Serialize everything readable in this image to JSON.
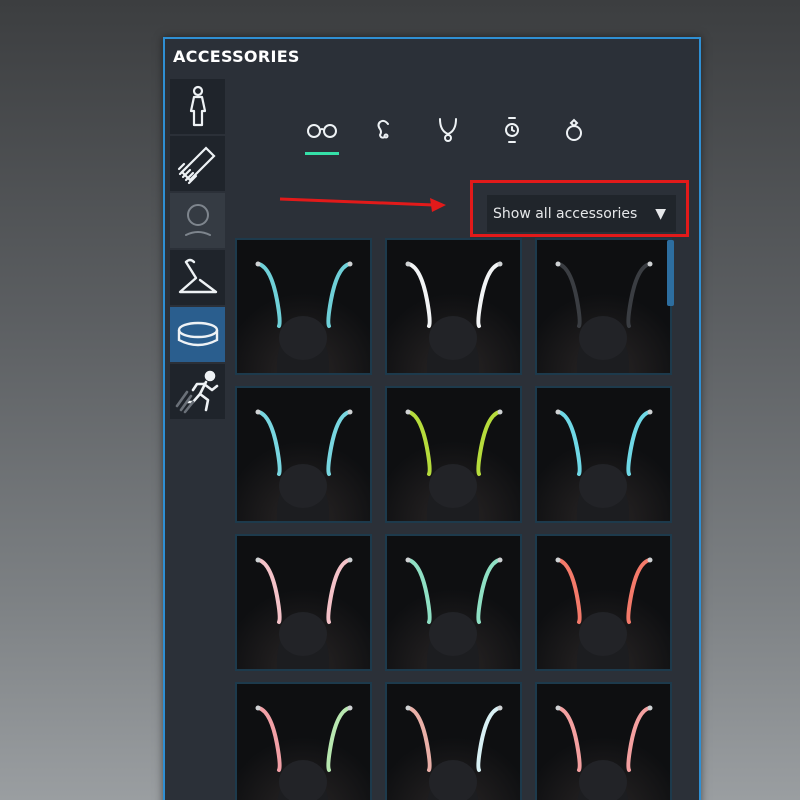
{
  "panel": {
    "title": "ACCESSORIES",
    "border_color": "#2f8fd3"
  },
  "sidebar": {
    "items": [
      {
        "name": "body-icon",
        "state": "normal"
      },
      {
        "name": "comb-icon",
        "state": "normal"
      },
      {
        "name": "head-icon",
        "state": "disabled"
      },
      {
        "name": "hanger-icon",
        "state": "normal"
      },
      {
        "name": "ring-band-icon",
        "state": "active"
      },
      {
        "name": "running-man-icon",
        "state": "normal"
      }
    ]
  },
  "category_tabs": [
    {
      "name": "glasses-icon",
      "selected": true
    },
    {
      "name": "ear-icon",
      "selected": false
    },
    {
      "name": "necklace-icon",
      "selected": false
    },
    {
      "name": "watch-icon",
      "selected": false
    },
    {
      "name": "ring-icon",
      "selected": false
    }
  ],
  "filter": {
    "label": "Show all accessories",
    "arrow": "▼"
  },
  "annotation": {
    "color": "#e21a1a"
  },
  "accessories": [
    {
      "left": "#6fd0d8",
      "right": "#6fd0d8"
    },
    {
      "left": "#f2f4f5",
      "right": "#f2f4f5"
    },
    {
      "left": "#3a3d42",
      "right": "#3a3d42"
    },
    {
      "left": "#78d6e0",
      "right": "#78d6e0"
    },
    {
      "left": "#b6dc3c",
      "right": "#b6dc3c"
    },
    {
      "left": "#6fd8e6",
      "right": "#6fd8e6"
    },
    {
      "left": "#f4c2c8",
      "right": "#f4c2c8"
    },
    {
      "left": "#8fe0c4",
      "right": "#8fe0c4"
    },
    {
      "left": "#f47a6a",
      "right": "#f47a6a"
    },
    {
      "left": "#f2a0a6",
      "right": "#b8e8b0"
    },
    {
      "left": "#eab0a8",
      "right": "#d8f0f4"
    },
    {
      "left": "#f4a0a0",
      "right": "#f4a0a0"
    }
  ]
}
